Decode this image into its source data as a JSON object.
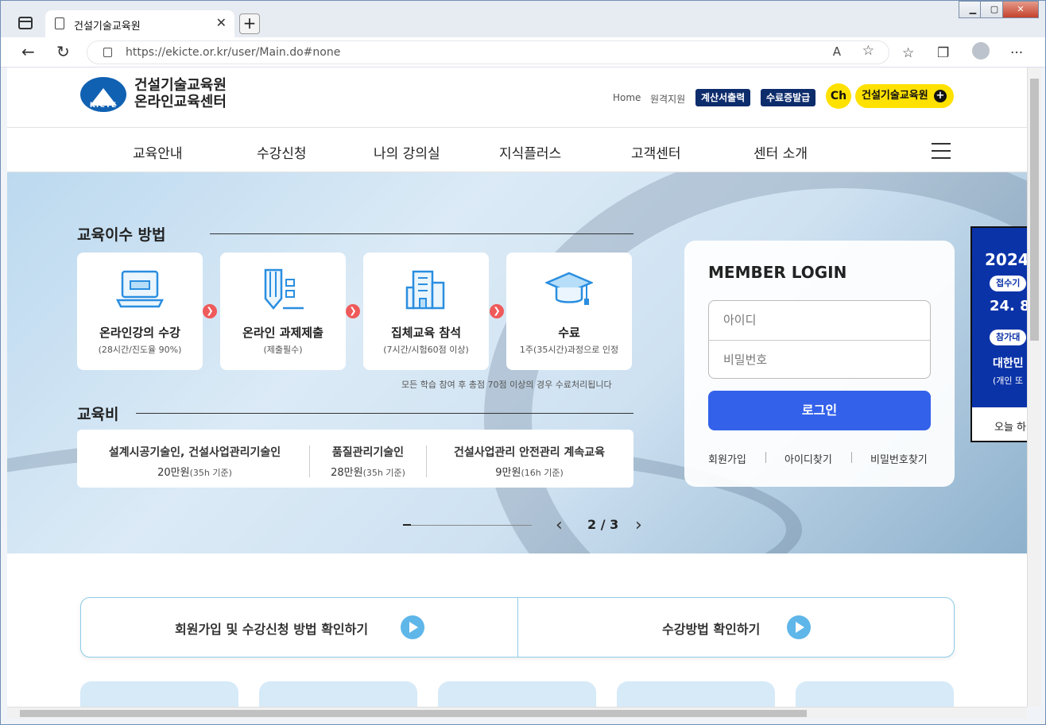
{
  "browser": {
    "tab_title": "건설기술교육원",
    "url": "https://ekicte.or.kr/user/Main.do#none"
  },
  "header": {
    "logo_badge": "KICTE",
    "logo_line1": "건설기술교육원",
    "logo_line2": "온라인교육센터",
    "links": [
      "Home",
      "원격지원"
    ],
    "buttons": [
      "계산서출력",
      "수료증발급"
    ],
    "ch_label": "Ch",
    "channel_label": "건설기술교육원"
  },
  "gnb": [
    "교육안내",
    "수강신청",
    "나의 강의실",
    "지식플러스",
    "고객센터",
    "센터 소개"
  ],
  "education": {
    "title": "교육이수 방법",
    "steps": [
      {
        "title": "온라인강의 수강",
        "sub": "(28시간/진도율 90%)",
        "icon": "laptop-icon"
      },
      {
        "title": "온라인 과제제출",
        "sub": "(제출필수)",
        "icon": "assignment-icon"
      },
      {
        "title": "집체교육 참석",
        "sub": "(7시간/시험60점 이상)",
        "icon": "building-icon"
      },
      {
        "title": "수료",
        "sub": "1주(35시간)과정으로 인정",
        "icon": "graduation-cap-icon"
      }
    ],
    "note": "모든 학습 참여 후 총점 70점 이상의 경우 수료처리됩니다"
  },
  "fees": {
    "title": "교육비",
    "items": [
      {
        "name": "설계시공기술인, 건설사업관리기술인",
        "price": "20만원",
        "unit": "(35h 기준)"
      },
      {
        "name": "품질관리기술인",
        "price": "28만원",
        "unit": "(35h 기준)"
      },
      {
        "name": "건설사업관리 안전관리 계속교육",
        "price": "9만원",
        "unit": "(16h 기준)"
      }
    ]
  },
  "slider": {
    "pager": "2 / 3"
  },
  "login": {
    "title": "MEMBER LOGIN",
    "id_placeholder": "아이디",
    "pw_placeholder": "비밀번호",
    "button": "로그인",
    "links": [
      "회원가입",
      "아이디찾기",
      "비밀번호찾기"
    ]
  },
  "popup": {
    "year": "2024",
    "tag1": "접수기",
    "date": "24. 8",
    "tag2": "참가대",
    "kr1": "대한민",
    "kr2": "(개인 또",
    "today": "오늘 하"
  },
  "guide": {
    "left": "회원가입 및 수강신청 방법 확인하기",
    "right": "수강방법 확인하기"
  }
}
